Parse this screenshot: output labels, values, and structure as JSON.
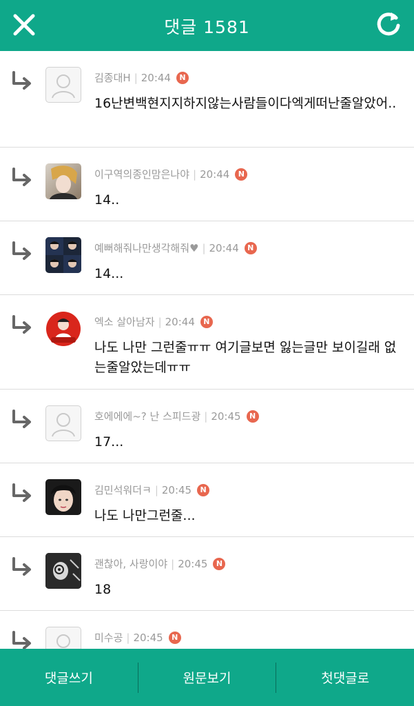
{
  "header": {
    "title": "댓글 1581"
  },
  "comments": [
    {
      "user": "김종대H",
      "time": "20:44",
      "badge": "N",
      "text": "16난변백현지지하지않는사람들이다엑게떠난줄알았어..",
      "avatar": "default"
    },
    {
      "user": "이구역의종인맘은나야",
      "time": "20:44",
      "badge": "N",
      "text": "14..",
      "avatar": "photo"
    },
    {
      "user": "예뻐해줘나만생각해줘♥",
      "time": "20:44",
      "badge": "N",
      "text": "14...",
      "avatar": "photo"
    },
    {
      "user": "엑소 살아남자",
      "time": "20:44",
      "badge": "N",
      "text": "나도 나만 그런줄ㅠㅠ 여기글보면 잃는글만 보이길래 없는줄알았는데ㅠㅠ",
      "avatar": "photo"
    },
    {
      "user": "호에에에~? 난 스피드광",
      "time": "20:45",
      "badge": "N",
      "text": "17...",
      "avatar": "default"
    },
    {
      "user": "김민석워더ㅋ",
      "time": "20:45",
      "badge": "N",
      "text": "나도 나만그런줄...",
      "avatar": "photo"
    },
    {
      "user": "괜찮아, 사랑이야",
      "time": "20:45",
      "badge": "N",
      "text": "18",
      "avatar": "photo"
    },
    {
      "user": "미수공",
      "time": "20:45",
      "badge": "N",
      "text": "",
      "avatar": "default"
    }
  ],
  "footer": {
    "write_label": "댓글쓰기",
    "original_label": "원문보기",
    "first_label": "첫댓글로"
  },
  "colors": {
    "brand": "#0fa88a",
    "badge": "#e8674f"
  }
}
